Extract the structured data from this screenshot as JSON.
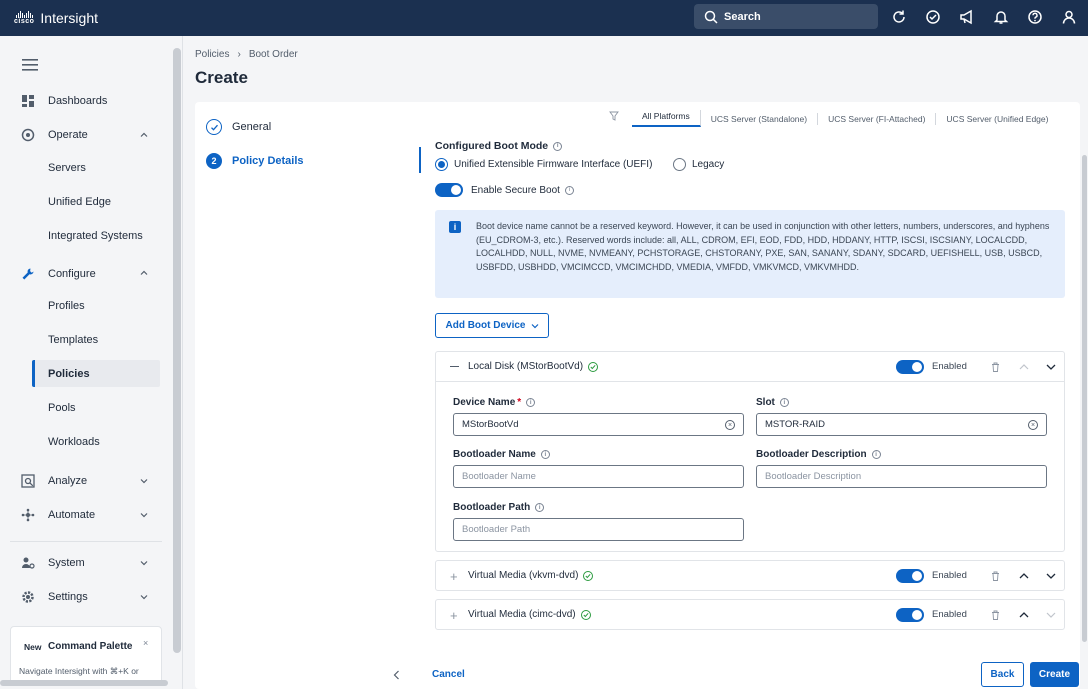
{
  "topbar": {
    "cisco_word": "cisco",
    "brand": "Intersight",
    "search_label": "Search",
    "icons": [
      "refresh-icon",
      "check-circle-icon",
      "megaphone-icon",
      "bell-icon",
      "help-icon",
      "user-icon"
    ]
  },
  "sidebar": {
    "dashboards": "Dashboards",
    "operate": "Operate",
    "operate_items": [
      "Servers",
      "Unified Edge",
      "Integrated Systems"
    ],
    "configure": "Configure",
    "configure_items": [
      "Profiles",
      "Templates",
      "Policies",
      "Pools",
      "Workloads"
    ],
    "active_item": "Policies",
    "analyze": "Analyze",
    "automate": "Automate",
    "system": "System",
    "settings": "Settings",
    "command_palette": {
      "badge": "New",
      "title": "Command Palette",
      "hint": "Navigate Intersight with ⌘+K or"
    }
  },
  "breadcrumb": [
    "Policies",
    "Boot Order"
  ],
  "page_title": "Create",
  "steps": [
    {
      "label": "General",
      "state": "done"
    },
    {
      "number": "2",
      "label": "Policy Details",
      "state": "active"
    }
  ],
  "platform_tabs": [
    "All Platforms",
    "UCS Server (Standalone)",
    "UCS Server (FI-Attached)",
    "UCS Server (Unified Edge)"
  ],
  "active_platform": "All Platforms",
  "boot_mode": {
    "label": "Configured Boot Mode",
    "options": [
      "Unified Extensible Firmware Interface (UEFI)",
      "Legacy"
    ],
    "selected": "Unified Extensible Firmware Interface (UEFI)"
  },
  "secure_boot": {
    "label": "Enable Secure Boot",
    "enabled": true
  },
  "banner": {
    "text": "Boot device name cannot be a reserved keyword. However, it can be used in conjunction with other letters, numbers, underscores, and hyphens (EU_CDROM-3, etc.). Reserved words include: all, ALL, CDROM, EFI, EOD, FDD, HDD, HDDANY, HTTP, ISCSI, ISCSIANY, LOCALCDD, LOCALHDD, NULL, NVME, NVMEANY, PCHSTORAGE, CHSTORANY, PXE, SAN, SANANY, SDANY, SDCARD, UEFISHELL, USB, USBCD, USBFDD, USBHDD, VMCIMCCD, VMCIMCHDD, VMEDIA, VMFDD, VMKVMCD, VMKVMHDD."
  },
  "add_boot_device": "Add Boot Device",
  "devices": [
    {
      "title": "Local Disk (MStorBootVd)",
      "enabled_label": "Enabled",
      "expanded": true,
      "fields": {
        "device_name_label": "Device Name",
        "device_name_value": "MStorBootVd",
        "slot_label": "Slot",
        "slot_value": "MSTOR-RAID",
        "bootloader_name_label": "Bootloader Name",
        "bootloader_name_placeholder": "Bootloader Name",
        "bootloader_desc_label": "Bootloader Description",
        "bootloader_desc_placeholder": "Bootloader Description",
        "bootloader_path_label": "Bootloader Path",
        "bootloader_path_placeholder": "Bootloader Path"
      }
    },
    {
      "title": "Virtual Media (vkvm-dvd)",
      "enabled_label": "Enabled",
      "expanded": false
    },
    {
      "title": "Virtual Media (cimc-dvd)",
      "enabled_label": "Enabled",
      "expanded": false
    }
  ],
  "footer": {
    "cancel": "Cancel",
    "back": "Back",
    "create": "Create"
  },
  "colors": {
    "topbar": "#1b3050",
    "accent": "#0d63c4",
    "banner_bg": "#e5eefc",
    "success": "#2b9a3f"
  }
}
